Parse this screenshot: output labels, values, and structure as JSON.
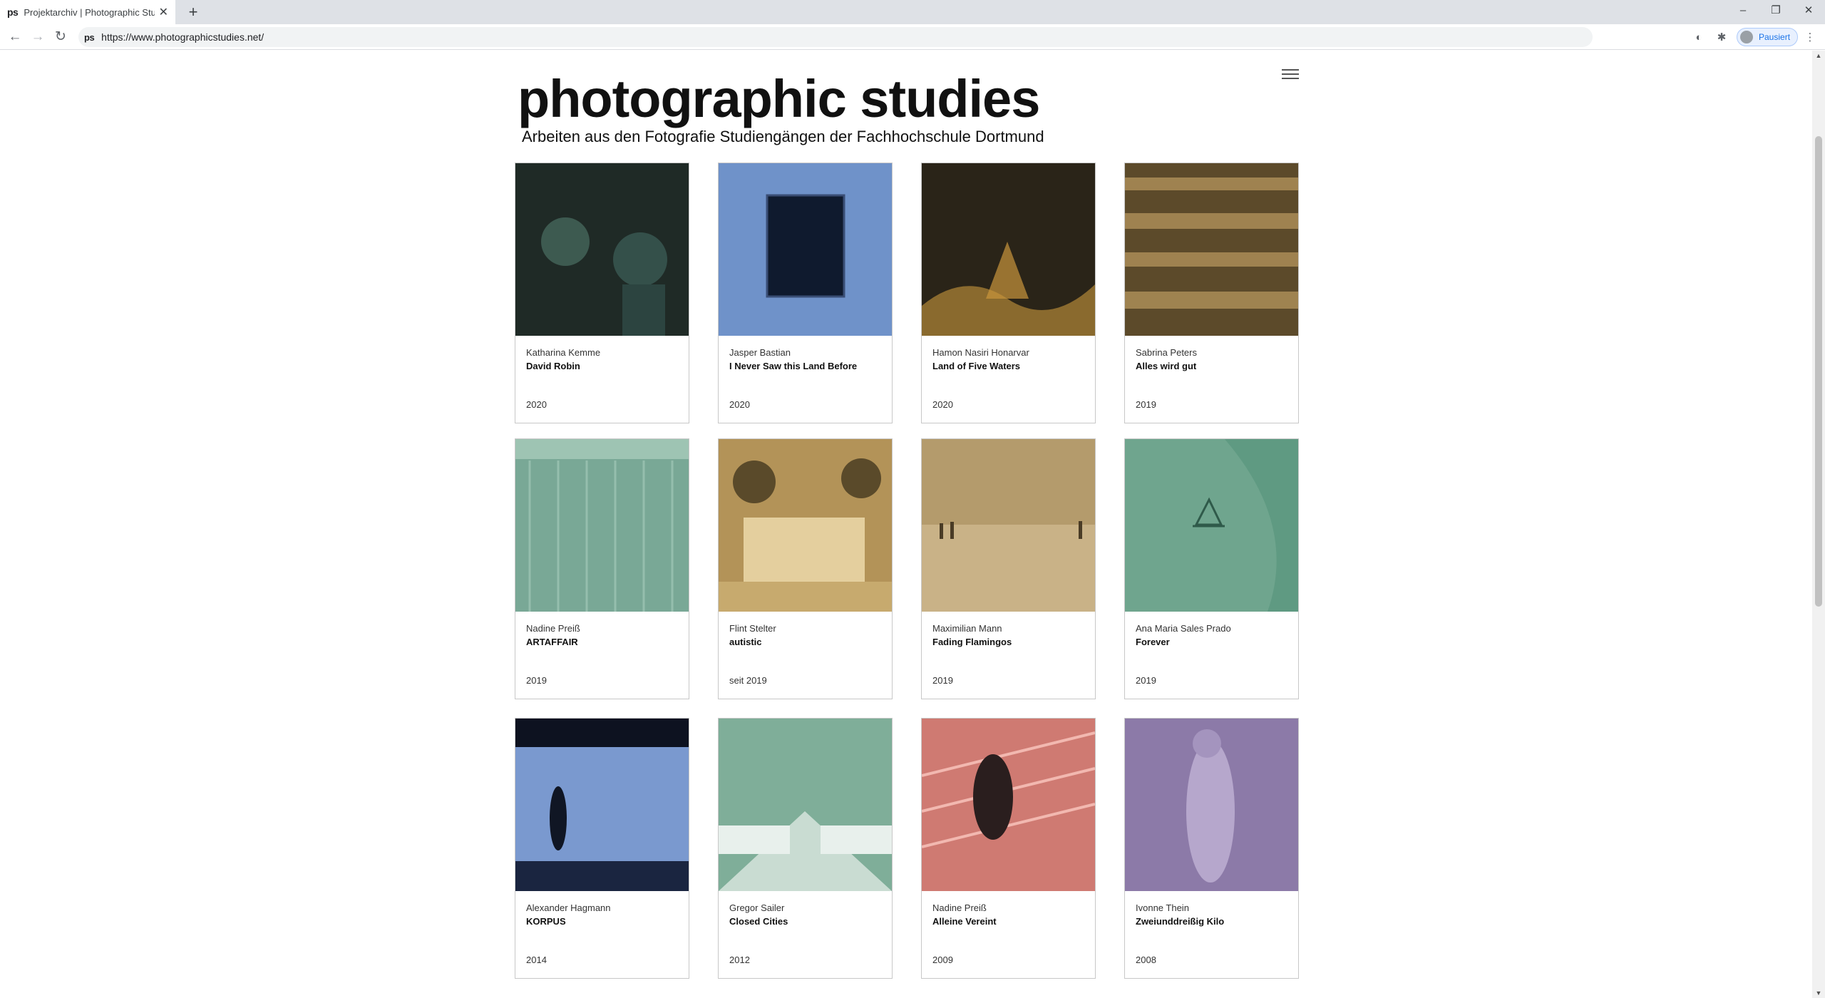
{
  "browser": {
    "tab_favicon": "ps",
    "tab_title": "Projektarchiv | Photographic Stud",
    "url": "https://www.photographicstudies.net/",
    "site_icon": "ps",
    "profile_label": "Pausiert"
  },
  "site": {
    "logo": "photographic studies",
    "subtitle": "Arbeiten aus den Fotografie Studiengängen der Fachhochschule Dortmund"
  },
  "projects": [
    {
      "author": "Katharina Kemme",
      "title": "David Robin",
      "year": "2020",
      "tint": "#1f2a26"
    },
    {
      "author": "Jasper Bastian",
      "title": "I Never Saw this Land Before",
      "year": "2020",
      "tint": "#6f92c9"
    },
    {
      "author": "Hamon Nasiri Honarvar",
      "title": "Land of Five Waters",
      "year": "2020",
      "tint": "#2a2418"
    },
    {
      "author": "Sabrina Peters",
      "title": "Alles wird gut",
      "year": "2019",
      "tint": "#5c4a2a"
    },
    {
      "author": "Nadine Preiß",
      "title": "ARTAFFAIR",
      "year": "2019",
      "tint": "#79a896"
    },
    {
      "author": "Flint Stelter",
      "title": "autistic",
      "year": "seit 2019",
      "tint": "#b39358"
    },
    {
      "author": "Maximilian Mann",
      "title": "Fading Flamingos",
      "year": "2019",
      "tint": "#b49b6c"
    },
    {
      "author": "Ana Maria Sales Prado",
      "title": "Forever",
      "year": "2019",
      "tint": "#6fa58e"
    },
    {
      "author": "Alexander Hagmann",
      "title": "KORPUS",
      "year": "2014",
      "tint": "#7a99cf"
    },
    {
      "author": "Gregor Sailer",
      "title": "Closed Cities",
      "year": "2012",
      "tint": "#7fae99"
    },
    {
      "author": "Nadine Preiß",
      "title": "Alleine Vereint",
      "year": "2009",
      "tint": "#cf7a72"
    },
    {
      "author": "Ivonne Thein",
      "title": "Zweiunddreißig Kilo",
      "year": "2008",
      "tint": "#8c7aa8"
    }
  ]
}
